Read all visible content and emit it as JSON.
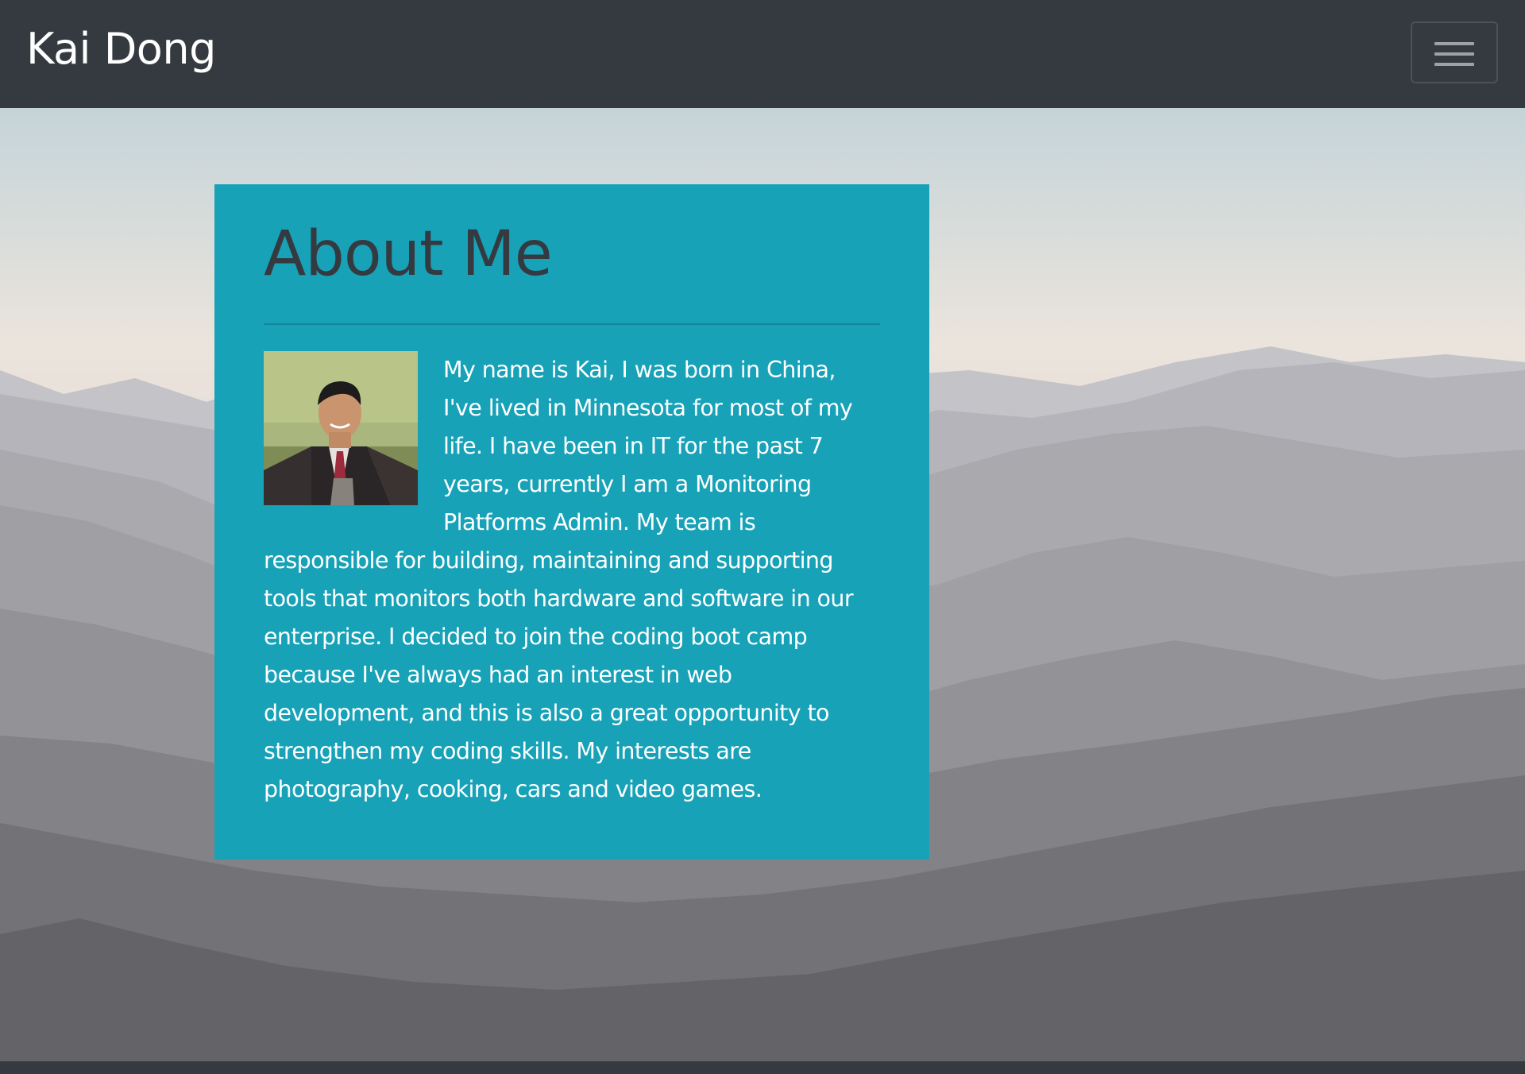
{
  "navbar": {
    "brand": "Kai Dong",
    "toggler_icon": "hamburger-menu-icon"
  },
  "about": {
    "title": "About Me",
    "bio": "My name is Kai, I was born in China, I've lived in Minnesota for most of my life. I have been in IT for the past 7 years, currently I am a Monitoring Platforms Admin. My team is responsible for building, maintaining and supporting tools that monitors both hardware and software in our enterprise. I decided to join the coding boot camp because I've always had an interest in web development, and this is also a great opportunity to strengthen my coding skills. My interests are photography, cooking, cars and video games."
  },
  "colors": {
    "navbar": "#343a40",
    "card": "#17a2b8",
    "title": "#343a40",
    "text": "#ffffff"
  }
}
